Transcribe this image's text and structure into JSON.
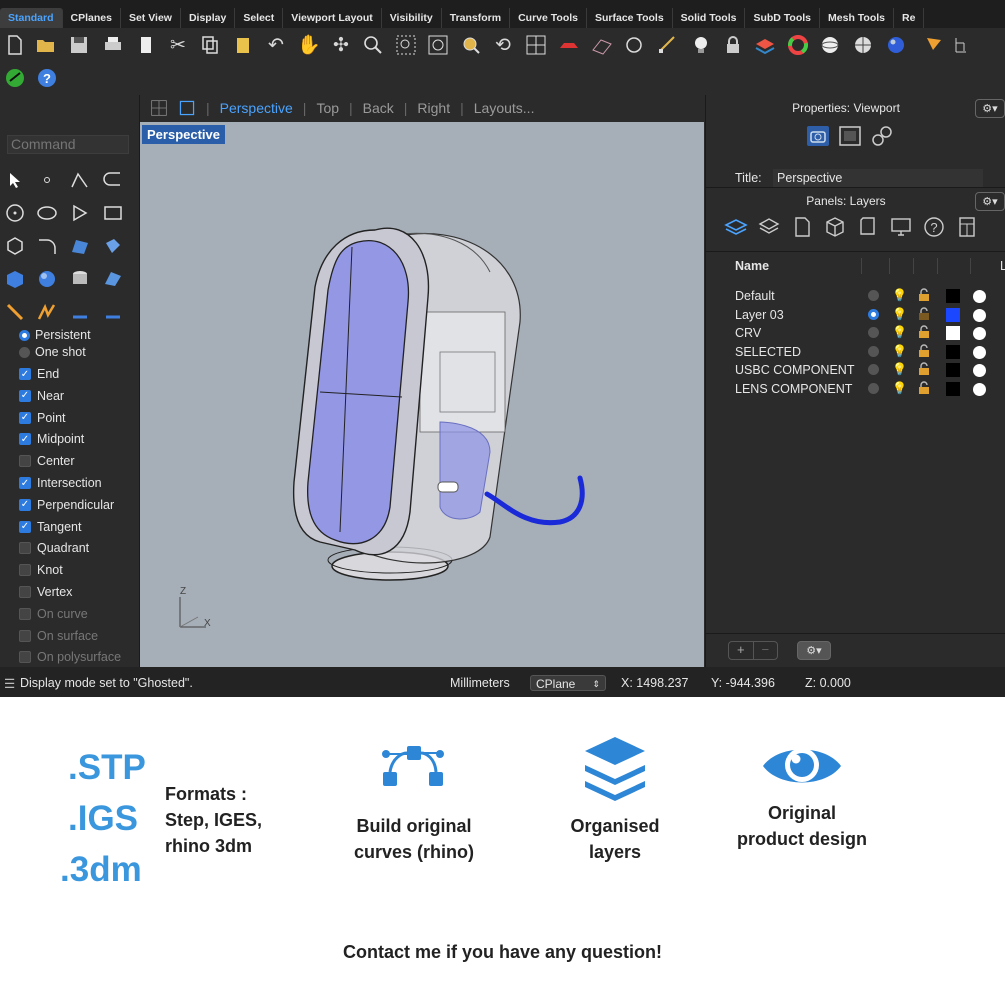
{
  "ribbon": {
    "tabs": [
      "Standard",
      "CPlanes",
      "Set View",
      "Display",
      "Select",
      "Viewport Layout",
      "Visibility",
      "Transform",
      "Curve Tools",
      "Surface Tools",
      "Solid Tools",
      "SubD Tools",
      "Mesh Tools",
      "Re"
    ],
    "active_tab": "Standard"
  },
  "command": {
    "placeholder": "Command"
  },
  "osnap": {
    "mode_persistent": "Persistent",
    "mode_oneshot": "One shot",
    "items": [
      {
        "label": "End",
        "checked": true
      },
      {
        "label": "Near",
        "checked": true
      },
      {
        "label": "Point",
        "checked": true
      },
      {
        "label": "Midpoint",
        "checked": true
      },
      {
        "label": "Center",
        "checked": false
      },
      {
        "label": "Intersection",
        "checked": true
      },
      {
        "label": "Perpendicular",
        "checked": true
      },
      {
        "label": "Tangent",
        "checked": true
      },
      {
        "label": "Quadrant",
        "checked": false
      },
      {
        "label": "Knot",
        "checked": false
      },
      {
        "label": "Vertex",
        "checked": false
      },
      {
        "label": "On curve",
        "checked": false,
        "disabled": true
      },
      {
        "label": "On surface",
        "checked": false,
        "disabled": true
      },
      {
        "label": "On polysurface",
        "checked": false,
        "disabled": true
      }
    ]
  },
  "viewport_tabs": {
    "perspective": "Perspective",
    "top": "Top",
    "back": "Back",
    "right": "Right",
    "layouts": "Layouts..."
  },
  "viewport": {
    "label": "Perspective",
    "axis_z": "Z",
    "axis_x": "X"
  },
  "properties": {
    "header": "Properties: Viewport",
    "title_label": "Title:",
    "title_value": "Perspective"
  },
  "layers": {
    "header": "Panels: Layers",
    "column_name": "Name",
    "column_extra": "L",
    "rows": [
      {
        "name": "Default",
        "current": false,
        "color": "#000000"
      },
      {
        "name": "Layer 03",
        "current": true,
        "color": "#1a47ff"
      },
      {
        "name": "CRV",
        "current": false,
        "color": "#ffffff"
      },
      {
        "name": "SELECTED",
        "current": false,
        "color": "#000000"
      },
      {
        "name": "USBC COMPONENT",
        "current": false,
        "color": "#000000"
      },
      {
        "name": "LENS COMPONENT",
        "current": false,
        "color": "#000000"
      }
    ],
    "add": "+",
    "remove": "−"
  },
  "status": {
    "message": "Display mode set to \"Ghosted\".",
    "units": "Millimeters",
    "cplane": "CPlane",
    "x": "X: 1498.237",
    "y": "Y: -944.396",
    "z": "Z: 0.000"
  },
  "promo": {
    "formats": [
      ".STP",
      ".IGS",
      ".3dm"
    ],
    "formats_title": "Formats :",
    "formats_line2": "Step, IGES,",
    "formats_line3": "rhino 3dm",
    "curves_line1": "Build original",
    "curves_line2": "curves (rhino)",
    "layers_line1": "Organised",
    "layers_line2": "layers",
    "design_line1": "Original",
    "design_line2": "product design",
    "contact": "Contact me if you have any question!"
  },
  "colors": {
    "accent": "#3a96dd",
    "active_tab": "#4aa3ff",
    "viewport_bg": "#a6aeb7"
  }
}
